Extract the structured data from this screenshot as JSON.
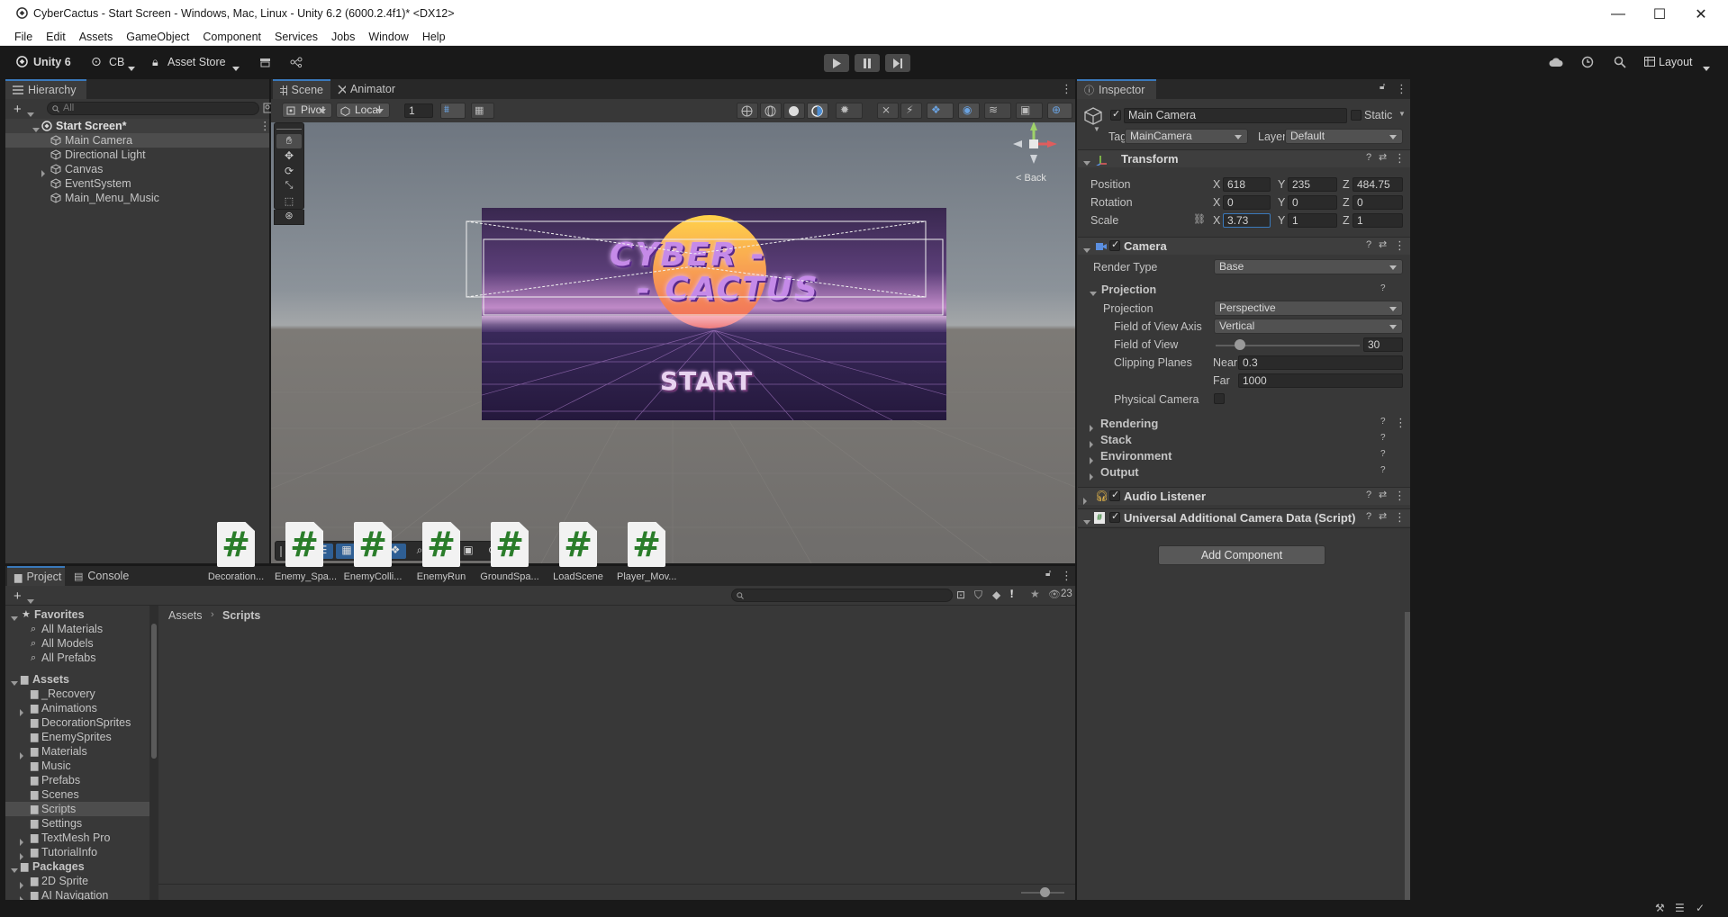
{
  "window": {
    "title": "CyberCactus - Start Screen - Windows, Mac, Linux - Unity 6.2 (6000.2.4f1)* <DX12>",
    "minimize": "—",
    "maximize": "☐",
    "close": "✕"
  },
  "menu": [
    "File",
    "Edit",
    "Assets",
    "GameObject",
    "Component",
    "Services",
    "Jobs",
    "Window",
    "Help"
  ],
  "toolbar": {
    "unity_label": "Unity 6",
    "account": "CB",
    "asset_store": "Asset Store",
    "layout": "Layout"
  },
  "hierarchy": {
    "tab": "Hierarchy",
    "search_placeholder": "All",
    "scene": "Start Screen*",
    "items": [
      "Main Camera",
      "Directional Light",
      "Canvas",
      "EventSystem",
      "Main_Menu_Music"
    ]
  },
  "scene_view": {
    "tabs": [
      "Scene",
      "Animator"
    ],
    "pivot": "Pivot",
    "local": "Local",
    "grid_value": "1",
    "back_label": "< Back",
    "gizmo_x": "x",
    "gizmo_y": "y",
    "game_title_line1": "CYBER -",
    "game_title_line2": "- CACTUS",
    "start_label": "START"
  },
  "inspector": {
    "tab": "Inspector",
    "object_name": "Main Camera",
    "static_label": "Static",
    "tag_label": "Tag",
    "tag_value": "MainCamera",
    "layer_label": "Layer",
    "layer_value": "Default",
    "transform": {
      "title": "Transform",
      "position_label": "Position",
      "rotation_label": "Rotation",
      "scale_label": "Scale",
      "position": {
        "x": "618",
        "y": "235",
        "z": "484.75"
      },
      "rotation": {
        "x": "0",
        "y": "0",
        "z": "0"
      },
      "scale": {
        "x": "3.73",
        "y": "1",
        "z": "1"
      },
      "axis_x": "X",
      "axis_y": "Y",
      "axis_z": "Z"
    },
    "camera": {
      "title": "Camera",
      "render_type_label": "Render Type",
      "render_type": "Base",
      "projection_section": "Projection",
      "projection_label": "Projection",
      "projection_value": "Perspective",
      "fov_axis_label": "Field of View Axis",
      "fov_axis_value": "Vertical",
      "fov_label": "Field of View",
      "fov_value": "30",
      "fov_fraction": 0.17,
      "clipping_label": "Clipping Planes",
      "near_label": "Near",
      "near_value": "0.3",
      "far_label": "Far",
      "far_value": "1000",
      "physical_label": "Physical Camera",
      "sections": [
        "Rendering",
        "Stack",
        "Environment",
        "Output"
      ]
    },
    "audio_listener": "Audio Listener",
    "additional_data": "Universal Additional Camera Data (Script)",
    "add_component": "Add Component"
  },
  "project": {
    "tabs": [
      "Project",
      "Console"
    ],
    "count": "23",
    "breadcrumb": [
      "Assets",
      "Scripts"
    ],
    "favorites_label": "Favorites",
    "favorites": [
      "All Materials",
      "All Models",
      "All Prefabs"
    ],
    "assets_label": "Assets",
    "folders": [
      "_Recovery",
      "Animations",
      "DecorationSprites",
      "EnemySprites",
      "Materials",
      "Music",
      "Prefabs",
      "Scenes",
      "Scripts",
      "Settings",
      "TextMesh Pro",
      "TutorialInfo"
    ],
    "packages_label": "Packages",
    "packages": [
      "2D Sprite",
      "AI Navigation"
    ],
    "files": [
      "Decoration...",
      "Enemy_Spa...",
      "EnemyColli...",
      "EnemyRun",
      "GroundSpa...",
      "LoadScene",
      "Player_Mov..."
    ],
    "script_glyph": "#"
  }
}
